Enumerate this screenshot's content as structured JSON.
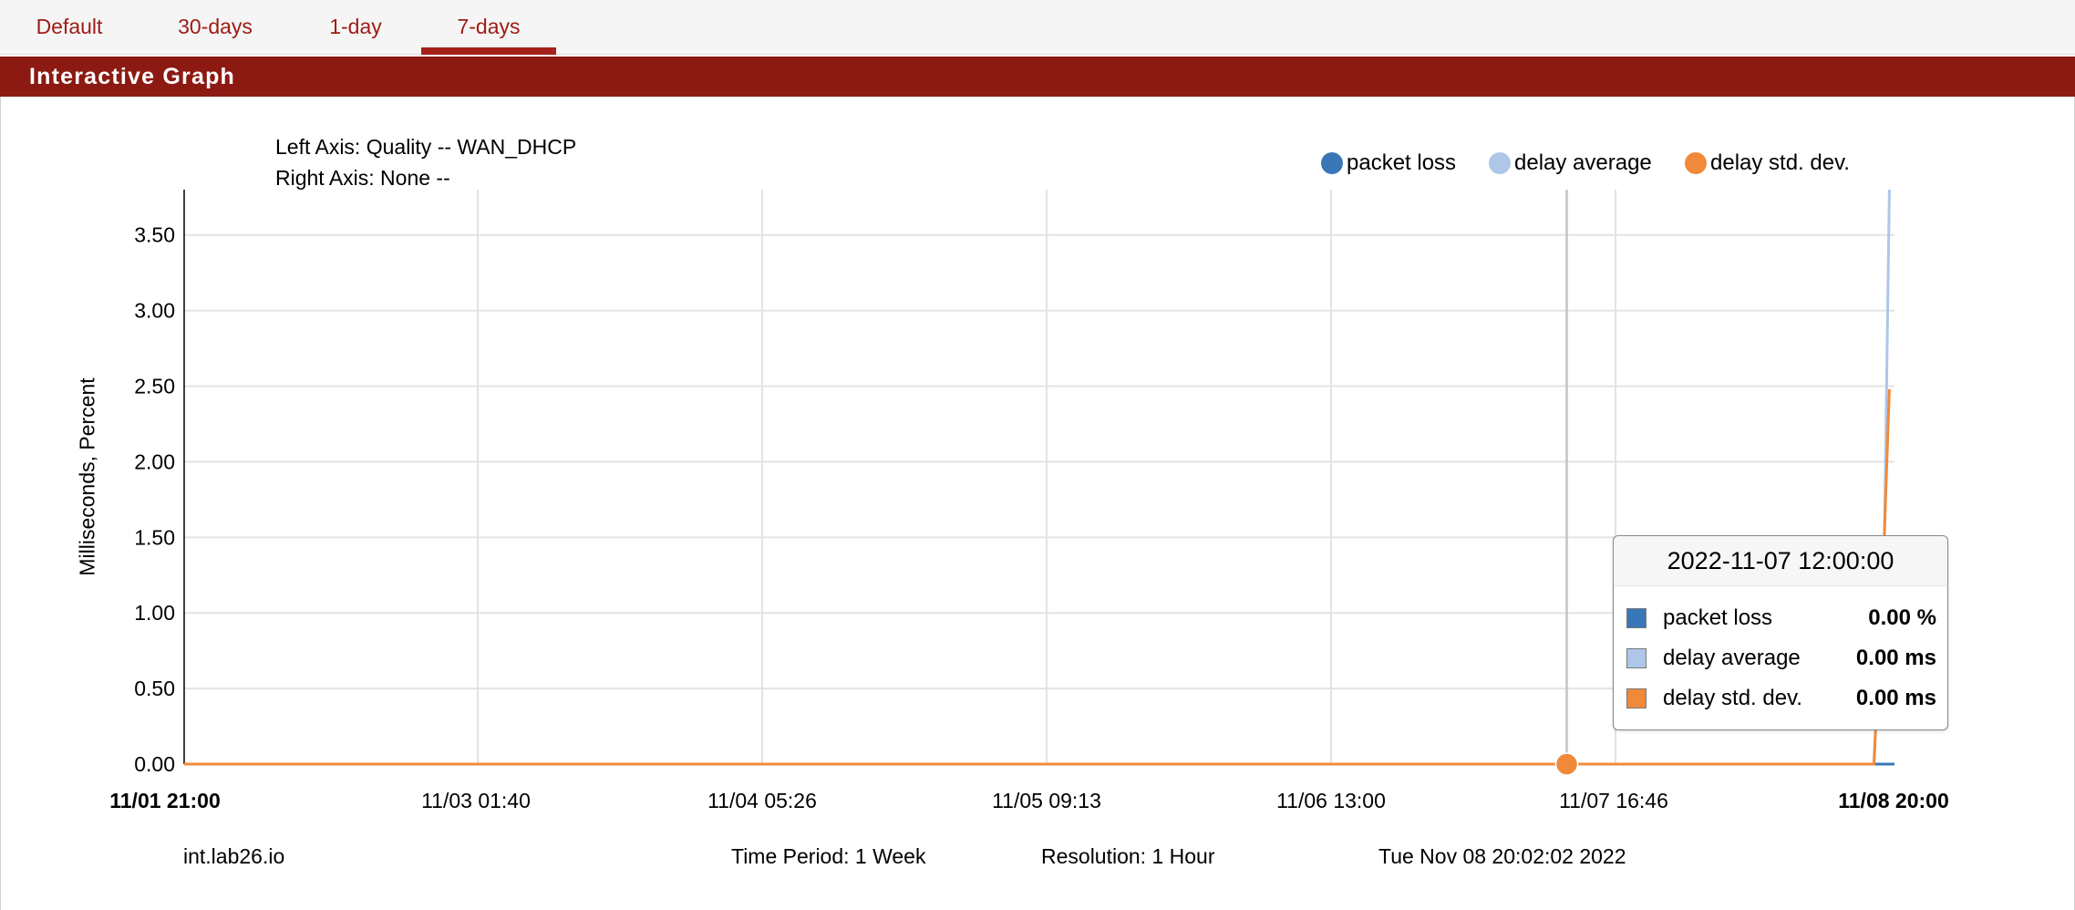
{
  "tabs": [
    {
      "label": "Default",
      "active": false
    },
    {
      "label": "30-days",
      "active": false
    },
    {
      "label": "1-day",
      "active": false
    },
    {
      "label": "7-days",
      "active": true
    }
  ],
  "panel": {
    "title": "Interactive Graph"
  },
  "axis_info": {
    "left": "Left Axis: Quality -- WAN_DHCP",
    "right": "Right Axis: None --"
  },
  "colors": {
    "accent": "#8c1a12",
    "tab_text": "#9e1b14",
    "packet_loss": "#3a77b8",
    "delay_average": "#aec6e8",
    "delay_std_dev": "#f08a3a"
  },
  "chart_data": {
    "type": "line",
    "ylabel": "Milliseconds, Percent",
    "ylim": [
      0,
      3.8
    ],
    "y_ticks": [
      "0.00",
      "0.50",
      "1.00",
      "1.50",
      "2.00",
      "2.50",
      "3.00",
      "3.50"
    ],
    "x_ticks": [
      "11/01 21:00",
      "11/03 01:40",
      "11/04 05:26",
      "11/05 09:13",
      "11/06 13:00",
      "11/07 16:46",
      "11/08 20:00"
    ],
    "x_ticks_bold": [
      "11/01 21:00",
      "11/08 20:00"
    ],
    "grid": true,
    "legend_position": "top-right",
    "hover_x": "2022-11-07 12:00",
    "series": [
      {
        "name": "packet loss",
        "color": "#3a77b8",
        "points": [
          [
            "2022-11-01 21:00",
            0
          ],
          [
            "2022-11-08 20:00",
            0
          ]
        ]
      },
      {
        "name": "delay average",
        "color": "#aec6e8",
        "points": [
          [
            "2022-11-01 21:00",
            0
          ],
          [
            "2022-11-08 18:00",
            0
          ],
          [
            "2022-11-08 19:00",
            1.4
          ],
          [
            "2022-11-08 19:30",
            3.8
          ]
        ]
      },
      {
        "name": "delay std. dev.",
        "color": "#f08a3a",
        "points": [
          [
            "2022-11-01 21:00",
            0
          ],
          [
            "2022-11-08 18:00",
            0
          ],
          [
            "2022-11-08 19:00",
            1.5
          ],
          [
            "2022-11-08 19:30",
            2.48
          ]
        ]
      }
    ]
  },
  "tooltip": {
    "title": "2022-11-07 12:00:00",
    "rows": [
      {
        "name": "packet loss",
        "value": "0.00 %",
        "color": "#3a77b8"
      },
      {
        "name": "delay average",
        "value": "0.00 ms",
        "color": "#aec6e8"
      },
      {
        "name": "delay std. dev.",
        "value": "0.00 ms",
        "color": "#f08a3a"
      }
    ]
  },
  "footer": {
    "host": "int.lab26.io",
    "period": "Time Period: 1 Week",
    "resolution": "Resolution: 1 Hour",
    "timestamp": "Tue Nov 08 20:02:02 2022"
  }
}
